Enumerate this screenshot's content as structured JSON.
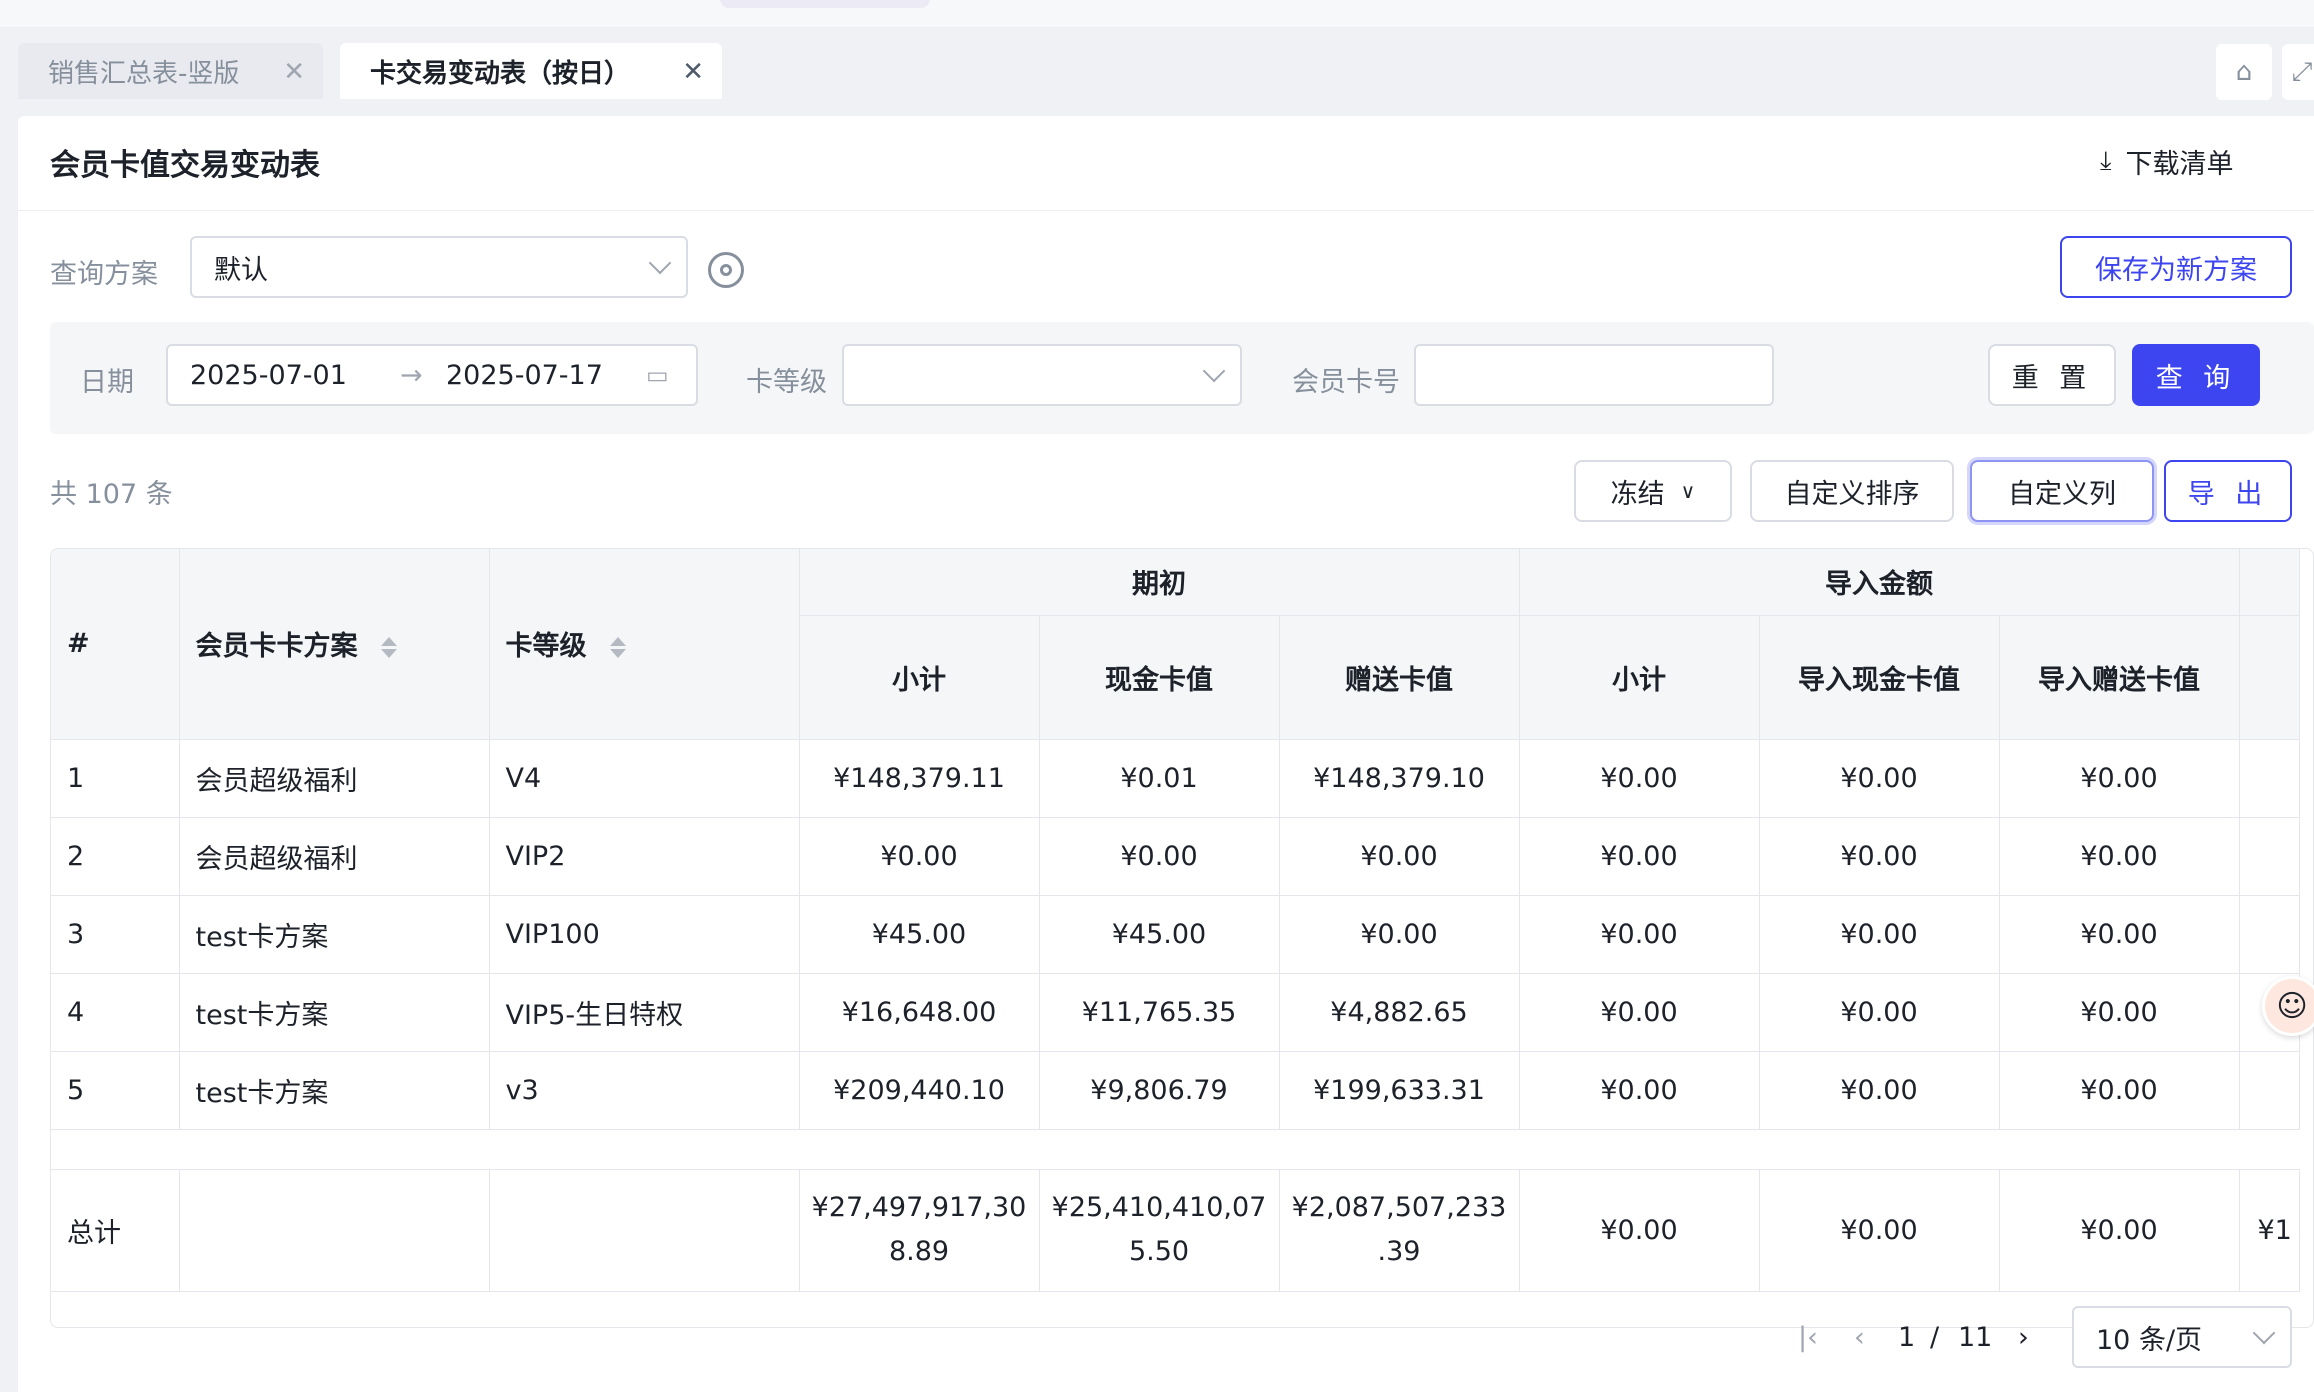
{
  "tabs": [
    {
      "label": "销售汇总表-竖版",
      "active": false
    },
    {
      "label": "卡交易变动表（按日）",
      "active": true
    }
  ],
  "page": {
    "title": "会员卡值交易变动表",
    "download_label": "下载清单"
  },
  "query": {
    "scheme_label": "查询方案",
    "scheme_value": "默认",
    "save_button": "保存为新方案"
  },
  "filters": {
    "date_label": "日期",
    "date_start": "2025-07-01",
    "date_end": "2025-07-17",
    "level_label": "卡等级",
    "level_value": "",
    "cardno_label": "会员卡号",
    "cardno_value": "",
    "reset_button": "重 置",
    "query_button": "查 询"
  },
  "toolbar": {
    "count": "共 107 条",
    "freeze": "冻结",
    "custom_sort": "自定义排序",
    "custom_cols": "自定义列",
    "export": "导 出"
  },
  "table": {
    "headers": {
      "idx": "#",
      "scheme": "会员卡卡方案",
      "level": "卡等级",
      "group_opening": "期初",
      "group_import": "导入金额",
      "sub": "小计",
      "cash": "现金卡值",
      "gift": "赠送卡值",
      "imp_sub": "小计",
      "imp_cash": "导入现金卡值",
      "imp_gift": "导入赠送卡值"
    },
    "rows": [
      [
        "1",
        "会员超级福利",
        "V4",
        "¥148,379.11",
        "¥0.01",
        "¥148,379.10",
        "¥0.00",
        "¥0.00",
        "¥0.00"
      ],
      [
        "2",
        "会员超级福利",
        "VIP2",
        "¥0.00",
        "¥0.00",
        "¥0.00",
        "¥0.00",
        "¥0.00",
        "¥0.00"
      ],
      [
        "3",
        "test卡方案",
        "VIP100",
        "¥45.00",
        "¥45.00",
        "¥0.00",
        "¥0.00",
        "¥0.00",
        "¥0.00"
      ],
      [
        "4",
        "test卡方案",
        "VIP5-生日特权",
        "¥16,648.00",
        "¥11,765.35",
        "¥4,882.65",
        "¥0.00",
        "¥0.00",
        "¥0.00"
      ],
      [
        "5",
        "test卡方案",
        "v3",
        "¥209,440.10",
        "¥9,806.79",
        "¥199,633.31",
        "¥0.00",
        "¥0.00",
        "¥0.00"
      ]
    ],
    "total": {
      "label": "总计",
      "sub_a": "¥27,497,917,30",
      "sub_b": "8.89",
      "cash_a": "¥25,410,410,07",
      "cash_b": "5.50",
      "gift_a": "¥2,087,507,233",
      "gift_b": ".39",
      "imp_sub": "¥0.00",
      "imp_cash": "¥0.00",
      "imp_gift": "¥0.00",
      "overflow": "¥1"
    }
  },
  "pagination": {
    "current": "1",
    "sep": "/",
    "total": "11",
    "page_size": "10 条/页"
  }
}
